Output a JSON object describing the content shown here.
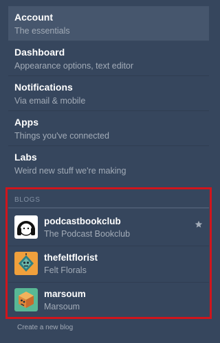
{
  "nav": {
    "items": [
      {
        "title": "Account",
        "subtitle": "The essentials"
      },
      {
        "title": "Dashboard",
        "subtitle": "Appearance options, text editor"
      },
      {
        "title": "Notifications",
        "subtitle": "Via email & mobile"
      },
      {
        "title": "Apps",
        "subtitle": "Things you've connected"
      },
      {
        "title": "Labs",
        "subtitle": "Weird new stuff we're making"
      }
    ]
  },
  "blogs": {
    "header": "BLOGS",
    "items": [
      {
        "name": "podcastbookclub",
        "title": "The Podcast Bookclub",
        "icon": "headphones-avatar-icon"
      },
      {
        "name": "thefeltflorist",
        "title": "Felt Florals",
        "icon": "orange-robot-avatar-icon"
      },
      {
        "name": "marsoum",
        "title": "Marsoum",
        "icon": "teal-cube-avatar-icon"
      }
    ],
    "primary_star_icon": "star-icon"
  },
  "create_blog_label": "Create a new blog",
  "colors": {
    "background": "#36465d",
    "active_item": "#46566d",
    "highlight_box": "#d0151c",
    "muted_text": "#a3acb8"
  }
}
